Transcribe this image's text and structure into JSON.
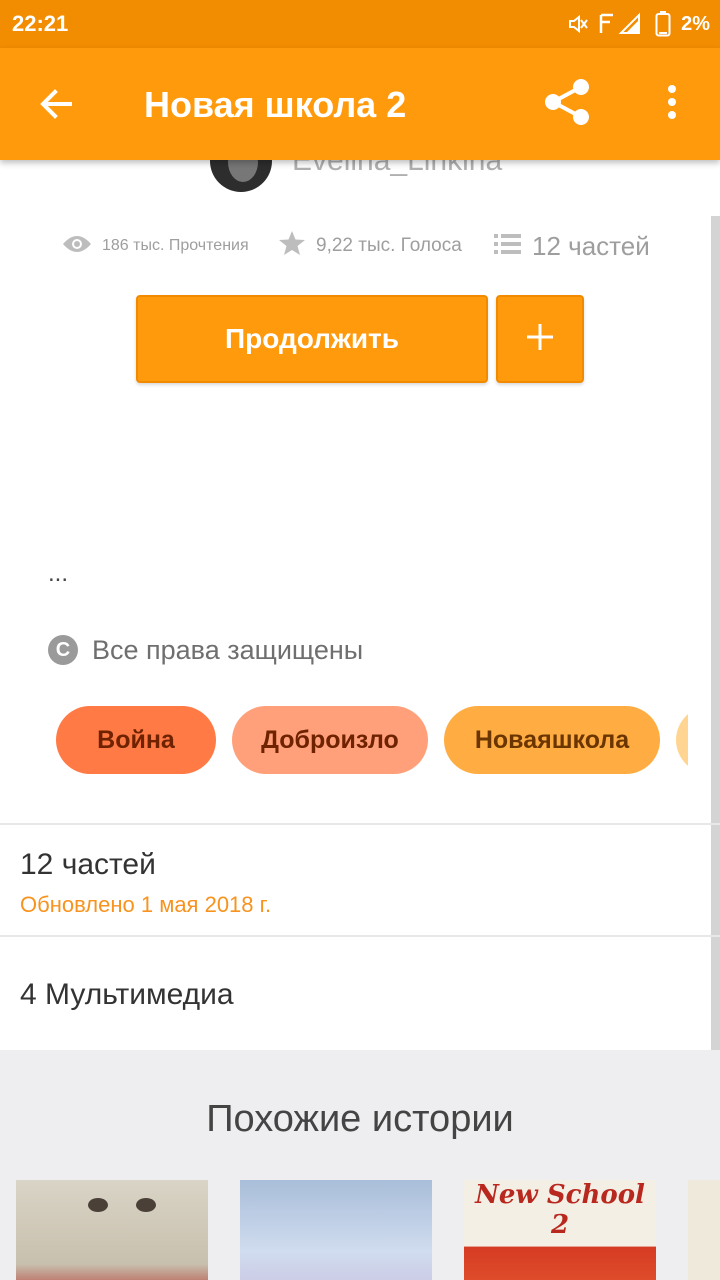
{
  "status_bar": {
    "time": "22:21",
    "battery": "2%",
    "icons": [
      "mute-icon",
      "signal-icon",
      "battery-icon"
    ]
  },
  "app_bar": {
    "title": "Новая школа 2",
    "icons": [
      "back-arrow-icon",
      "share-icon",
      "more-vertical-icon"
    ]
  },
  "story": {
    "author": "Evelina_Linkina",
    "stats": {
      "reads": "186 тыс. Прочтения",
      "votes": "9,22 тыс. Голоса",
      "parts": "12 частей"
    },
    "continue_label": "Продолжить",
    "add_label": "+",
    "description": "...",
    "copyright_symbol": "C",
    "copyright": "Все права защищены",
    "tags": [
      "Война",
      "Доброизло",
      "Новаяшкола"
    ]
  },
  "parts_section": {
    "title": "12 частей",
    "updated": "Обновлено 1 мая 2018 г."
  },
  "media_section": {
    "title": "4 Мультимедиа"
  },
  "similar": {
    "title": "Похожие истории",
    "covers": [
      {
        "title": ""
      },
      {
        "title": ""
      },
      {
        "title": "New School 2"
      },
      {
        "title": ""
      }
    ]
  },
  "colors": {
    "status_bar": "#f28c00",
    "app_bar": "#ff9a0d",
    "accent_text": "#f7931e",
    "tag_1": "#ff7a45",
    "tag_2": "#ffa07a",
    "tag_3": "#ffad42"
  }
}
